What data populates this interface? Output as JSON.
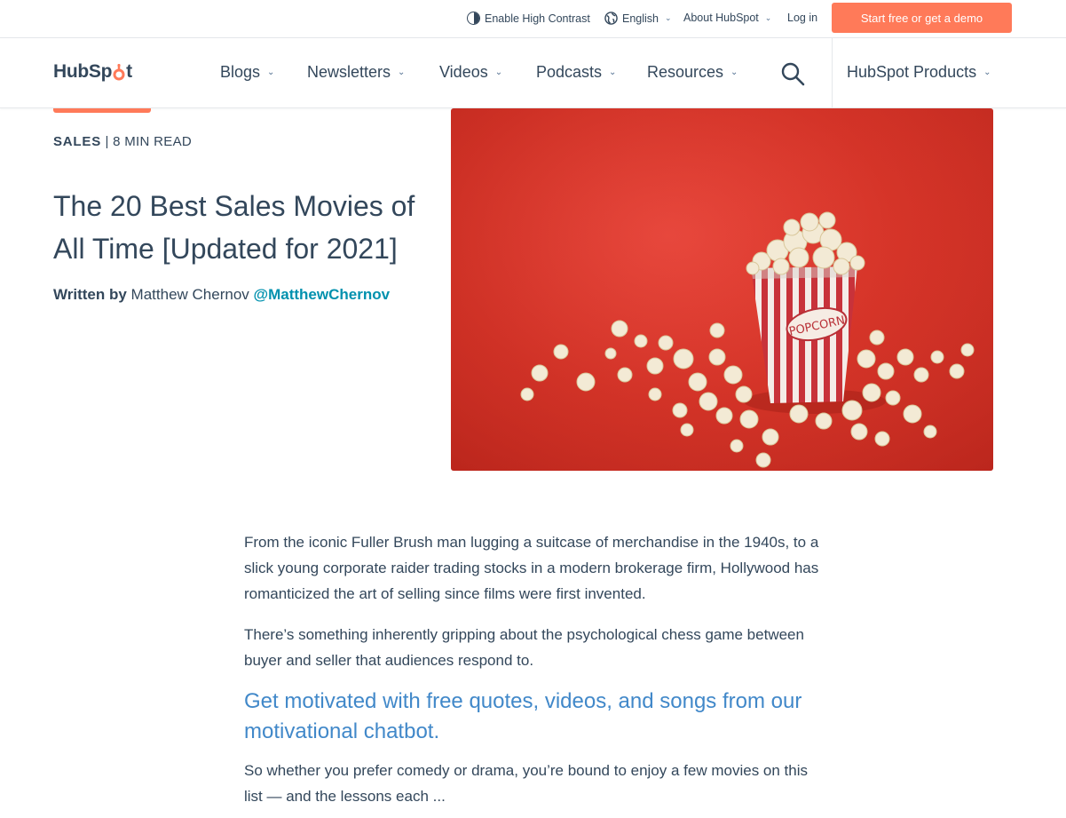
{
  "util_bar": {
    "high_contrast": "Enable High Contrast",
    "language": "English",
    "about": "About HubSpot",
    "login": "Log in",
    "cta": "Start free or get a demo"
  },
  "nav": {
    "logo_prefix": "HubSp",
    "logo_suffix": "t",
    "items": [
      {
        "label": "Blogs"
      },
      {
        "label": "Newsletters"
      },
      {
        "label": "Videos"
      },
      {
        "label": "Podcasts"
      },
      {
        "label": "Resources"
      }
    ],
    "products": "HubSpot Products"
  },
  "article": {
    "category": "SALES",
    "separator": "|",
    "read_time": "8 MIN READ",
    "title": "The 20 Best Sales Movies of All Time [Updated for 2021]",
    "written_by": "Written by",
    "author": "Matthew Chernov",
    "handle": "@MatthewChernov",
    "hero_image_text": "POPCORN",
    "paragraphs": [
      "From the iconic Fuller Brush man lugging a suitcase of merchandise in the 1940s, to a slick young corporate raider trading stocks in a modern brokerage firm, Hollywood has romanticized the art of selling since films were first invented.",
      "There’s something inherently gripping about the psychological chess game between buyer and seller that audiences respond to."
    ],
    "cta_heading": "Get motivated with free quotes, videos, and songs from our motivational chatbot.",
    "paragraph_3": "So whether you prefer comedy or drama, you’re bound to enjoy a few movies on this list — and the lessons each ..."
  },
  "colors": {
    "accent": "#ff7a59",
    "text": "#33475b",
    "link": "#0091ae",
    "cta_heading": "#4188c9"
  }
}
